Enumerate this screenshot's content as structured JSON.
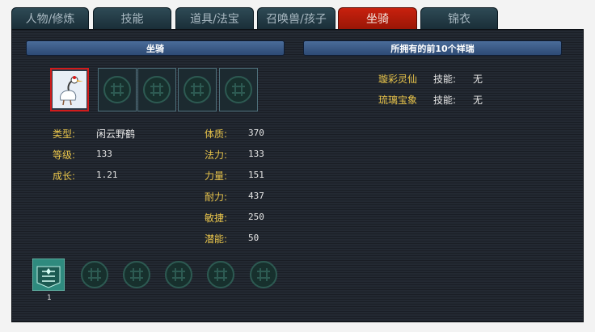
{
  "tabs": [
    {
      "label": "人物/修炼",
      "active": false
    },
    {
      "label": "技能",
      "active": false
    },
    {
      "label": "道具/法宝",
      "active": false
    },
    {
      "label": "召唤兽/孩子",
      "active": false
    },
    {
      "label": "坐骑",
      "active": true
    },
    {
      "label": "锦衣",
      "active": false
    }
  ],
  "mount_header": "坐骑",
  "top10_header": "所拥有的前10个祥瑞",
  "mount": {
    "type_label": "类型:",
    "type_value": "闲云野鹤",
    "level_label": "等级:",
    "level_value": "133",
    "growth_label": "成长:",
    "growth_value": "1.21"
  },
  "stats": [
    {
      "label": "体质:",
      "value": "370"
    },
    {
      "label": "法力:",
      "value": "133"
    },
    {
      "label": "力量:",
      "value": "151"
    },
    {
      "label": "耐力:",
      "value": "437"
    },
    {
      "label": "敏捷:",
      "value": "250"
    },
    {
      "label": "潜能:",
      "value": "50"
    }
  ],
  "auspicious": [
    {
      "name": "璇彩灵仙",
      "skill_label": "技能:",
      "skill_value": "无"
    },
    {
      "name": "琉璃宝象",
      "skill_label": "技能:",
      "skill_value": "无"
    }
  ],
  "equip_count": "1",
  "colors": {
    "active_tab": "#c8210e",
    "label_gold": "#e9c54b",
    "header_blue": "#3a5a8a"
  }
}
